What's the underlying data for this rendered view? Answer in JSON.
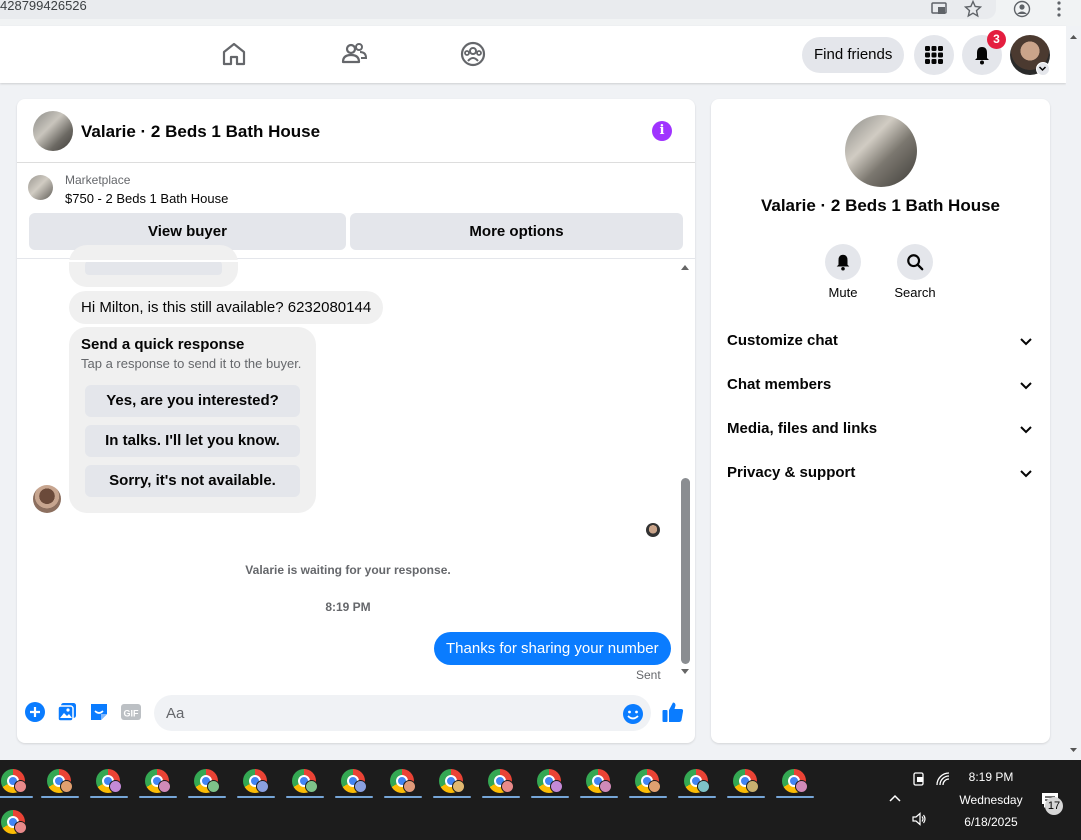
{
  "browser": {
    "url_fragment": "428799426526"
  },
  "topnav": {
    "find_friends_label": "Find friends",
    "notification_count": "3"
  },
  "chat": {
    "title": "Valarie · 2 Beds 1 Bath House",
    "listing_source": "Marketplace",
    "listing_price_title": "$750 - 2 Beds 1 Bath House",
    "view_buyer_label": "View buyer",
    "more_options_label": "More options",
    "incoming_message": "Hi Milton, is this still available? 6232080144",
    "quick_response": {
      "title": "Send a quick response",
      "subtitle": "Tap a response to send it to the buyer.",
      "options": [
        "Yes, are you interested?",
        "In talks. I'll let you know.",
        "Sorry, it's not available."
      ]
    },
    "waiting_text": "Valarie is waiting for your response.",
    "timestamp": "8:19 PM",
    "outgoing_message": "Thanks for sharing your number",
    "sent_status": "Sent",
    "input_placeholder": "Aa"
  },
  "info_panel": {
    "title": "Valarie · 2 Beds 1 Bath House",
    "mute_label": "Mute",
    "search_label": "Search",
    "sections": [
      "Customize chat",
      "Chat members",
      "Media, files and links",
      "Privacy & support"
    ]
  },
  "taskbar": {
    "app_count": 18,
    "time": "8:19 PM",
    "day": "Wednesday",
    "date": "6/18/2025",
    "notifications": "17"
  },
  "colors": {
    "accent": "#0a7cff",
    "info_icon": "#a033ff",
    "badge": "#e41e3f"
  }
}
